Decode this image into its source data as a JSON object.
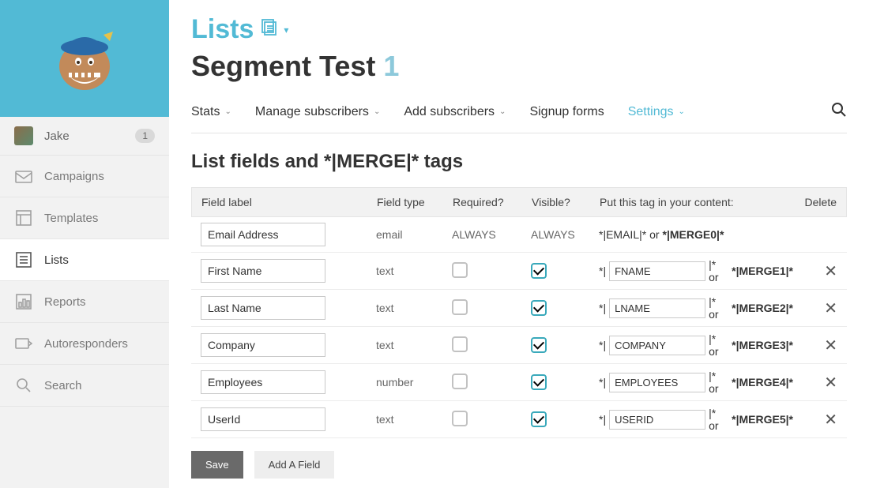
{
  "sidebar": {
    "user": {
      "name": "Jake",
      "badge": "1"
    },
    "items": [
      {
        "label": "Campaigns"
      },
      {
        "label": "Templates"
      },
      {
        "label": "Lists"
      },
      {
        "label": "Reports"
      },
      {
        "label": "Autoresponders"
      },
      {
        "label": "Search"
      }
    ]
  },
  "breadcrumb": {
    "title": "Lists"
  },
  "page": {
    "title_main": "Segment Test",
    "title_num": "1"
  },
  "tabs": {
    "stats": "Stats",
    "manage": "Manage subscribers",
    "add": "Add subscribers",
    "signup": "Signup forms",
    "settings": "Settings"
  },
  "section_heading": "List fields and *|MERGE|* tags",
  "table": {
    "headers": {
      "label": "Field label",
      "type": "Field type",
      "required": "Required?",
      "visible": "Visible?",
      "tag": "Put this tag in your content:",
      "delete": "Delete"
    },
    "rows": [
      {
        "label": "Email Address",
        "type": "email",
        "required": "ALWAYS",
        "visible": "ALWAYS",
        "tag_text": "*|EMAIL|* or ",
        "merge_bold": "*|MERGE0|*",
        "editable_tag": false
      },
      {
        "label": "First Name",
        "type": "text",
        "required_checked": false,
        "visible_checked": true,
        "tag_pre": "*|",
        "tag_value": "FNAME",
        "tag_post": "|* or ",
        "merge_bold": "*|MERGE1|*",
        "editable_tag": true
      },
      {
        "label": "Last Name",
        "type": "text",
        "required_checked": false,
        "visible_checked": true,
        "tag_pre": "*|",
        "tag_value": "LNAME",
        "tag_post": "|* or ",
        "merge_bold": "*|MERGE2|*",
        "editable_tag": true
      },
      {
        "label": "Company",
        "type": "text",
        "required_checked": false,
        "visible_checked": true,
        "tag_pre": "*|",
        "tag_value": "COMPANY",
        "tag_post": "|* or ",
        "merge_bold": "*|MERGE3|*",
        "editable_tag": true
      },
      {
        "label": "Employees",
        "type": "number",
        "required_checked": false,
        "visible_checked": true,
        "tag_pre": "*|",
        "tag_value": "EMPLOYEES",
        "tag_post": "|* or ",
        "merge_bold": "*|MERGE4|*",
        "editable_tag": true
      },
      {
        "label": "UserId",
        "type": "text",
        "required_checked": false,
        "visible_checked": true,
        "tag_pre": "*|",
        "tag_value": "USERID",
        "tag_post": "|* or ",
        "merge_bold": "*|MERGE5|*",
        "editable_tag": true
      }
    ]
  },
  "buttons": {
    "save": "Save",
    "add_field": "Add A Field"
  }
}
